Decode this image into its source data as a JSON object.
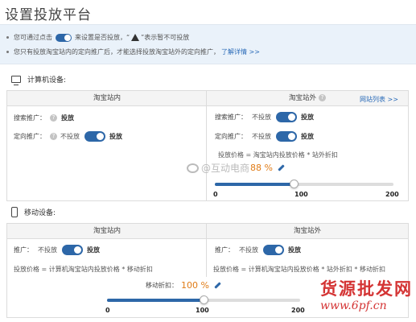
{
  "page": {
    "title": "设置投放平台"
  },
  "notice": {
    "line1_prefix": "您可通过点击",
    "line1_mid": "来设置是否投放，“",
    "line1_suffix": "”表示暂不可投放",
    "line2_text": "您只有投放淘宝站内的定向推广后，才能选择投放淘宝站外的定向推广，",
    "line2_link": "了解详情 >>"
  },
  "computer": {
    "heading": "计算机设备:",
    "inside": {
      "header": "淘宝站内",
      "search_label": "搜索推广：",
      "search_status": "投放",
      "targeting_label": "定向推广：",
      "targeting_off": "不投放",
      "targeting_on": "投放"
    },
    "outside": {
      "header": "淘宝站外",
      "site_list_link": "网站列表 >>",
      "search_label": "搜索推广：",
      "search_off": "不投放",
      "search_on": "投放",
      "targeting_label": "定向推广：",
      "targeting_off": "不投放",
      "targeting_on": "投放",
      "formula": "投放价格 = 淘宝站内投放价格 * 站外折扣",
      "discount_value": "88 %",
      "discount_percent": 88,
      "slider_min": "0",
      "slider_mid": "100",
      "slider_max": "200"
    }
  },
  "mobile": {
    "heading": "移动设备:",
    "inside": {
      "header": "淘宝站内",
      "promo_label": "推广：",
      "promo_off": "不投放",
      "promo_on": "投放",
      "formula": "投放价格 = 计算机淘宝站内投放价格 * 移动折扣"
    },
    "outside": {
      "header": "淘宝站外",
      "promo_label": "推广：",
      "promo_off": "不投放",
      "promo_on": "投放",
      "formula": "投放价格 = 计算机淘宝站内投放价格 * 站外折扣 * 移动折扣"
    },
    "discount_label": "移动折扣：",
    "discount_value": "100 %",
    "discount_percent": 100,
    "slider_min": "0",
    "slider_mid": "100",
    "slider_max": "200"
  },
  "watermarks": {
    "center": "@互动电商",
    "logo": "货源批发网",
    "url": "www.6pf.cn"
  },
  "colors": {
    "accent": "#2d67a8",
    "discount": "#e07b16",
    "link": "#2a6bb8",
    "watermark": "#d43434"
  }
}
